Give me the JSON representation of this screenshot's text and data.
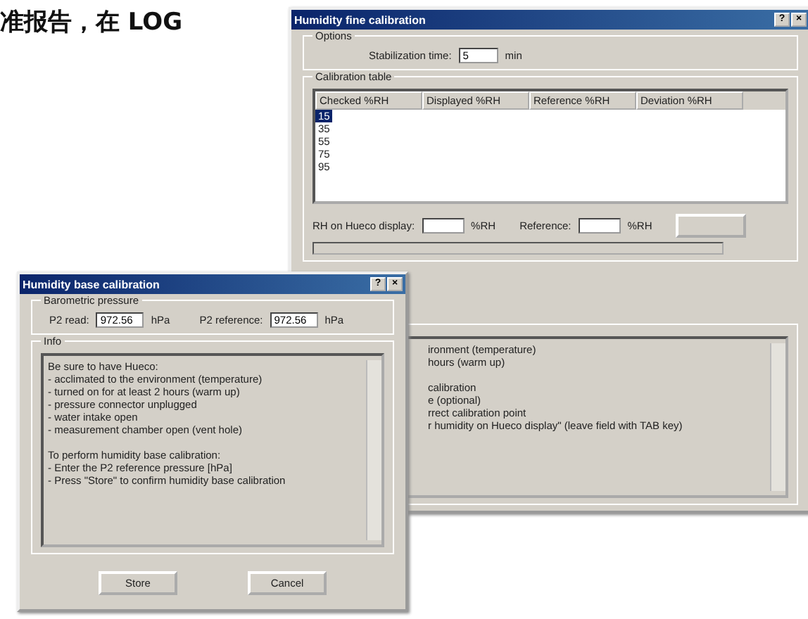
{
  "page_text": "准报告，在 LOG",
  "fine_window": {
    "title": "Humidity fine calibration",
    "title_buttons": [
      "?",
      "×"
    ],
    "options": {
      "heading": "Options",
      "label": "Stabilization time:",
      "value": "5",
      "unit": "min"
    },
    "calibration_table": {
      "heading": "Calibration table",
      "columns": [
        "Checked %RH",
        "Displayed %RH",
        "Reference %RH",
        "Deviation %RH"
      ],
      "rows": [
        {
          "cells": [
            "15"
          ],
          "selected": true
        },
        {
          "cells": [
            "35"
          ],
          "selected": false
        },
        {
          "cells": [
            "55"
          ],
          "selected": false
        },
        {
          "cells": [
            "75"
          ],
          "selected": false
        },
        {
          "cells": [
            "95"
          ],
          "selected": false
        }
      ]
    },
    "rh_label": "RH on Hueco display:",
    "rh_unit": "%RH",
    "reference_label": "Reference:",
    "reference_unit": "%RH",
    "progress": {
      "level": 0
    },
    "info_paragraphs": [
      [
        "ironment (temperature)",
        "hours (warm up)"
      ],
      [
        "calibration",
        "e (optional)",
        "rrect calibration point",
        "r humidity on Hueco display\" (leave field with TAB key)"
      ]
    ]
  },
  "base_window": {
    "title": "Humidity base calibration",
    "title_buttons": [
      "?",
      "×"
    ],
    "pressure": {
      "heading": "Barometric pressure",
      "read_label": "P2 read:",
      "read_value": "972.56",
      "read_unit": "hPa",
      "reference_label": "P2 reference:",
      "reference_value": "972.56",
      "reference_unit": "hPa"
    },
    "info": {
      "heading": "Info",
      "paragraphs": [
        [
          "Be sure to have Hueco:",
          "- acclimated to the environment (temperature)",
          "- turned on for at least 2 hours (warm up)",
          "- pressure connector unplugged",
          "- water intake open",
          "- measurement chamber open (vent hole)"
        ],
        [
          "To perform humidity base calibration:",
          "- Enter the P2 reference pressure [hPa]",
          "- Press \"Store\" to confirm humidity base calibration"
        ]
      ]
    },
    "buttons": [
      "Store",
      "Cancel"
    ]
  }
}
